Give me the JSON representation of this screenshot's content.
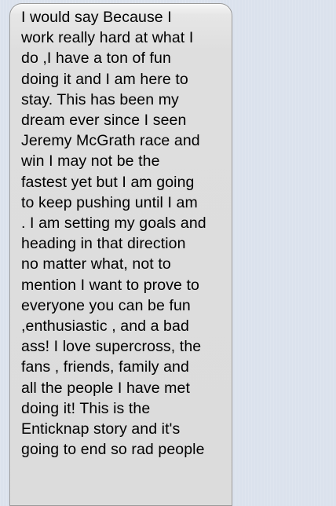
{
  "conversation": {
    "message": {
      "lines": [
        "I would say Because I",
        "work really hard at what I",
        "do ,I have a ton of fun",
        "doing it and I am here to",
        "stay. This has been my",
        "dream ever since I seen",
        "Jeremy McGrath race and",
        "win I may not be the",
        "fastest yet but I am going",
        "to keep pushing until I am",
        ". I am setting my goals and",
        "heading in that direction",
        "no matter what, not to",
        "mention I want to prove to",
        "everyone you can be fun",
        ",enthusiastic , and a bad",
        "ass! I love supercross, the",
        "fans , friends, family and",
        "all the people I have met",
        "doing it! This is the",
        "Enticknap story and it's",
        "going to end so rad people"
      ]
    }
  }
}
